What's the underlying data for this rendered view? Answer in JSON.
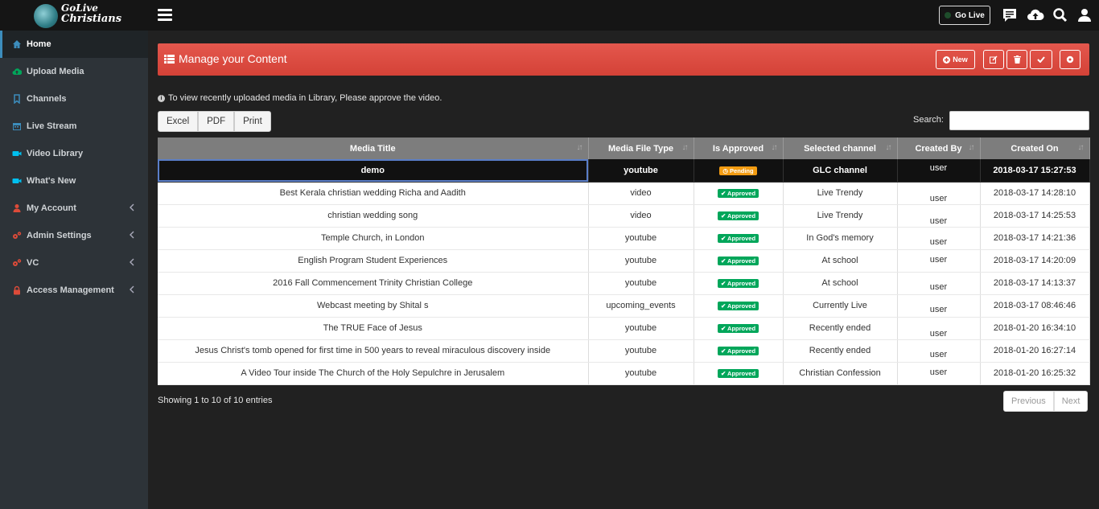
{
  "brand": {
    "line1": "GoLive",
    "line2": "Christians"
  },
  "topbar": {
    "go_live_label": "Go Live"
  },
  "sidebar": {
    "items": [
      {
        "label": "Home",
        "icon": "home-icon",
        "color": "#3c8dbc"
      },
      {
        "label": "Upload Media",
        "icon": "cloud-upload-icon",
        "color": "#00a65a"
      },
      {
        "label": "Channels",
        "icon": "bookmark-icon",
        "color": "#3c8dbc"
      },
      {
        "label": "Live Stream",
        "icon": "calendar-icon",
        "color": "#3c8dbc"
      },
      {
        "label": "Video Library",
        "icon": "video-camera-icon",
        "color": "#00c0ef"
      },
      {
        "label": "What's New",
        "icon": "video-camera-icon",
        "color": "#00c0ef"
      },
      {
        "label": "My Account",
        "icon": "user-icon",
        "color": "#dd4b39"
      },
      {
        "label": "Admin Settings",
        "icon": "gears-icon",
        "color": "#dd4b39"
      },
      {
        "label": "VC",
        "icon": "gears-icon",
        "color": "#dd4b39"
      },
      {
        "label": "Access Management",
        "icon": "lock-icon",
        "color": "#dd4b39"
      }
    ]
  },
  "header": {
    "title": "Manage your Content",
    "new_label": "New"
  },
  "info_text": "To view recently uploaded media in Library, Please approve the video.",
  "export": {
    "excel": "Excel",
    "pdf": "PDF",
    "print": "Print"
  },
  "search": {
    "label": "Search:",
    "value": ""
  },
  "table": {
    "columns": [
      "Media Title",
      "Media File Type",
      "Is Approved",
      "Selected channel",
      "Created By",
      "Created On"
    ],
    "rows": [
      {
        "title": "demo",
        "type": "youtube",
        "status": "Pending",
        "channel": "GLC channel",
        "by": "user",
        "on": "2018-03-17 15:27:53"
      },
      {
        "title": "Best Kerala christian wedding Richa and Aadith",
        "type": "video",
        "status": "Approved",
        "channel": "Live Trendy",
        "by": "user",
        "on": "2018-03-17 14:28:10"
      },
      {
        "title": "christian wedding song",
        "type": "video",
        "status": "Approved",
        "channel": "Live Trendy",
        "by": "user",
        "on": "2018-03-17 14:25:53"
      },
      {
        "title": "Temple Church, in London",
        "type": "youtube",
        "status": "Approved",
        "channel": "In God's memory",
        "by": "user",
        "on": "2018-03-17 14:21:36"
      },
      {
        "title": "English Program Student Experiences",
        "type": "youtube",
        "status": "Approved",
        "channel": "At school",
        "by": "user",
        "on": "2018-03-17 14:20:09"
      },
      {
        "title": "2016 Fall Commencement Trinity Christian College",
        "type": "youtube",
        "status": "Approved",
        "channel": "At school",
        "by": "user",
        "on": "2018-03-17 14:13:37"
      },
      {
        "title": "Webcast meeting by Shital s",
        "type": "upcoming_events",
        "status": "Approved",
        "channel": "Currently Live",
        "by": "user",
        "on": "2018-03-17 08:46:46"
      },
      {
        "title": "The TRUE Face of Jesus",
        "type": "youtube",
        "status": "Approved",
        "channel": "Recently ended",
        "by": "user",
        "on": "2018-01-20 16:34:10"
      },
      {
        "title": "Jesus Christ's tomb opened for first time in 500 years to reveal miraculous discovery inside",
        "type": "youtube",
        "status": "Approved",
        "channel": "Recently ended",
        "by": "user",
        "on": "2018-01-20 16:27:14"
      },
      {
        "title": "A Video Tour inside The Church of the Holy Sepulchre in Jerusalem",
        "type": "youtube",
        "status": "Approved",
        "channel": "Christian Confession",
        "by": "user",
        "on": "2018-01-20 16:25:32"
      }
    ]
  },
  "footer": {
    "showing": "Showing 1 to 10 of 10 entries",
    "previous": "Previous",
    "next": "Next"
  }
}
